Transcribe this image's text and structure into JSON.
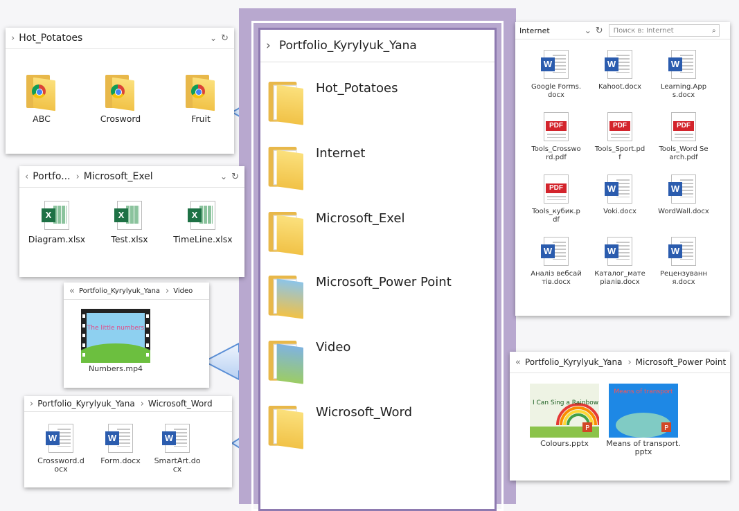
{
  "colors": {
    "accent": "#b8a8cf",
    "accent_dark": "#8e7ab0",
    "arrow_fill": "#cfe0f7",
    "arrow_stroke": "#5b8fd6",
    "word": "#2b5cae",
    "excel": "#1e7145",
    "pdf": "#d3242c"
  },
  "center": {
    "path": "Portfolio_Kyrylyuk_Yana",
    "folders": [
      {
        "name": "Hot_Potatoes",
        "icon": "folder-icon"
      },
      {
        "name": "Internet",
        "icon": "folder-icon"
      },
      {
        "name": "Microsoft_Exel",
        "icon": "folder-icon"
      },
      {
        "name": "Microsoft_Power Point",
        "icon": "folder-icon"
      },
      {
        "name": "Video",
        "icon": "folder-icon"
      },
      {
        "name": "Wicrosoft_Word",
        "icon": "folder-icon"
      }
    ]
  },
  "hot_potatoes": {
    "path": "Hot_Potatoes",
    "items": [
      "ABC",
      "Crosword",
      "Fruit"
    ]
  },
  "excel": {
    "path_prefix": "Portfo...",
    "path": "Microsoft_Exel",
    "items": [
      "Diagram.xlsx",
      "Test.xlsx",
      "TimeLine.xlsx"
    ]
  },
  "video": {
    "path_root": "Portfolio_Kyrylyuk_Yana",
    "path": "Video",
    "items": [
      "Numbers.mp4"
    ],
    "thumb_text": "The little numbers"
  },
  "word": {
    "path_root": "Portfolio_Kyrylyuk_Yana",
    "path": "Wicrosoft_Word",
    "items": [
      "Crossword.docx",
      "Form.docx",
      "SmartArt.docx"
    ]
  },
  "internet": {
    "path": "Internet",
    "search_placeholder": "Поиск в: Internet",
    "items": [
      {
        "name": "Google Forms.docx",
        "type": "w"
      },
      {
        "name": "Kahoot.docx",
        "type": "w"
      },
      {
        "name": "Learning.Apps.docx",
        "type": "w"
      },
      {
        "name": "Tools_Crossword.pdf",
        "type": "pdf"
      },
      {
        "name": "Tools_Sport.pdf",
        "type": "pdf"
      },
      {
        "name": "Tools_Word Search.pdf",
        "type": "pdf"
      },
      {
        "name": "Tools_кубик.pdf",
        "type": "pdf"
      },
      {
        "name": "Voki.docx",
        "type": "w"
      },
      {
        "name": "WordWall.docx",
        "type": "w"
      },
      {
        "name": "Аналіз вебсайтів.docx",
        "type": "w"
      },
      {
        "name": "Каталог_матеріалів.docx",
        "type": "w"
      },
      {
        "name": "Рецензування.docx",
        "type": "w"
      }
    ],
    "pdf_badge": "PDF"
  },
  "powerpoint": {
    "path_root": "Portfolio_Kyrylyuk_Yana",
    "path": "Microsoft_Power Point",
    "items": [
      "Colours.pptx",
      "Means of transport.pptx"
    ],
    "thumb1_text": "I Can Sing a Rainbow",
    "thumb2_text": "Means of transport"
  }
}
